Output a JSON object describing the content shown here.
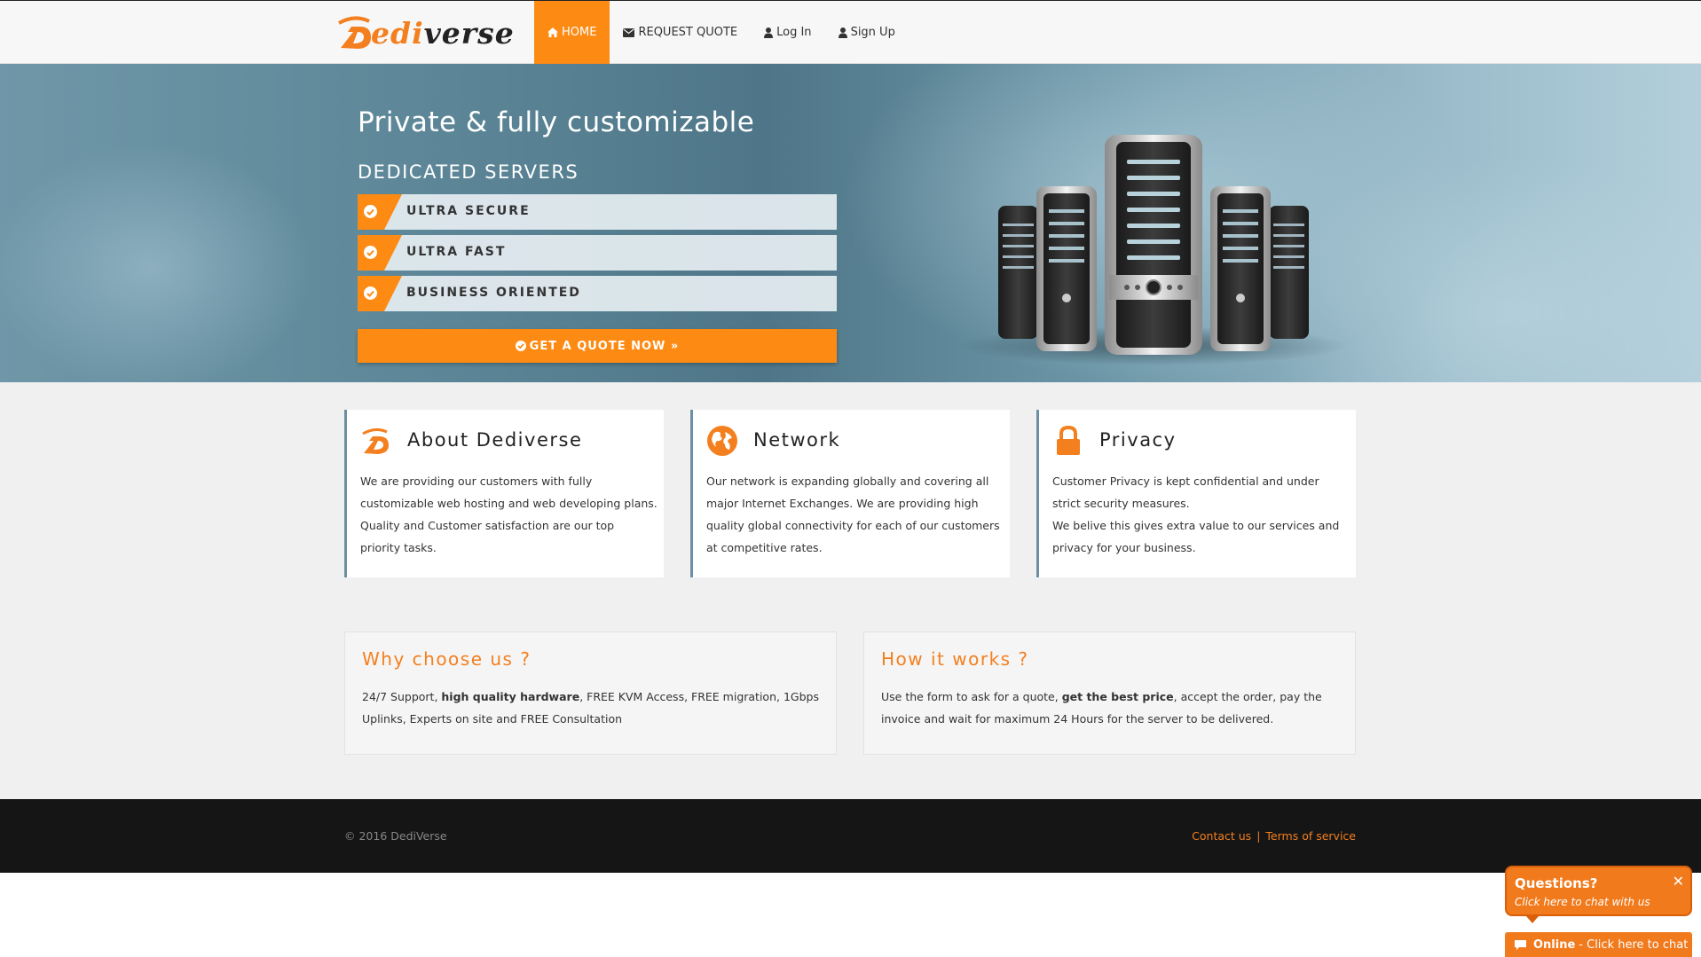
{
  "brand": {
    "logo_prefix": "ediverse",
    "logo_edi": "edi",
    "logo_verse": "verse",
    "accent": "#fd8a12",
    "accent_dark": "#f47f1f"
  },
  "nav": {
    "items": [
      {
        "label": "HOME",
        "icon": "home-icon",
        "active": true
      },
      {
        "label": "REQUEST QUOTE",
        "icon": "envelope-icon"
      },
      {
        "label": "Log In",
        "icon": "user-icon"
      },
      {
        "label": "Sign Up",
        "icon": "user-icon"
      }
    ]
  },
  "hero": {
    "title": "Private & fully customizable",
    "subtitle": "DEDICATED SERVERS",
    "features": [
      "ULTRA SECURE",
      "ULTRA FAST",
      "BUSINESS ORIENTED"
    ],
    "cta_label": "GET A QUOTE NOW »"
  },
  "cards": [
    {
      "title": "About Dediverse",
      "icon": "dediverse-logo-icon",
      "body": "We are providing our customers with fully customizable web hosting and web developing plans. Quality and Customer satisfaction are our top priority tasks."
    },
    {
      "title": "Network",
      "icon": "globe-icon",
      "body": "Our network is expanding globally and covering all major Internet Exchanges. We are providing high quality global connectivity for each of our customers at competitive rates."
    },
    {
      "title": "Privacy",
      "icon": "lock-icon",
      "body_line1": "Customer Privacy is kept confidential and under strict security measures.",
      "body_line2": "We belive this gives extra value to our services and privacy for your business."
    }
  ],
  "panels": {
    "why": {
      "title": "Why choose us ?",
      "pre": "24/7 Support, ",
      "bold": "high quality hardware",
      "post": ", FREE KVM Access, FREE migration, 1Gbps Uplinks, Experts on site and FREE Consultation"
    },
    "how": {
      "title": "How it works ?",
      "pre": "Use the form to ask for a quote, ",
      "bold": "get the best price",
      "post": ", accept the order, pay the invoice and wait for maximum 24 Hours for the server to be delivered."
    }
  },
  "footer": {
    "copyright": "© 2016 DediVerse",
    "links": [
      "Contact us",
      "Terms of service"
    ],
    "separator": "|"
  },
  "chat": {
    "title": "Questions?",
    "subtitle": "Click here to chat with us",
    "close": "✕",
    "online_label": "Online",
    "online_text": "- Click here to chat"
  }
}
